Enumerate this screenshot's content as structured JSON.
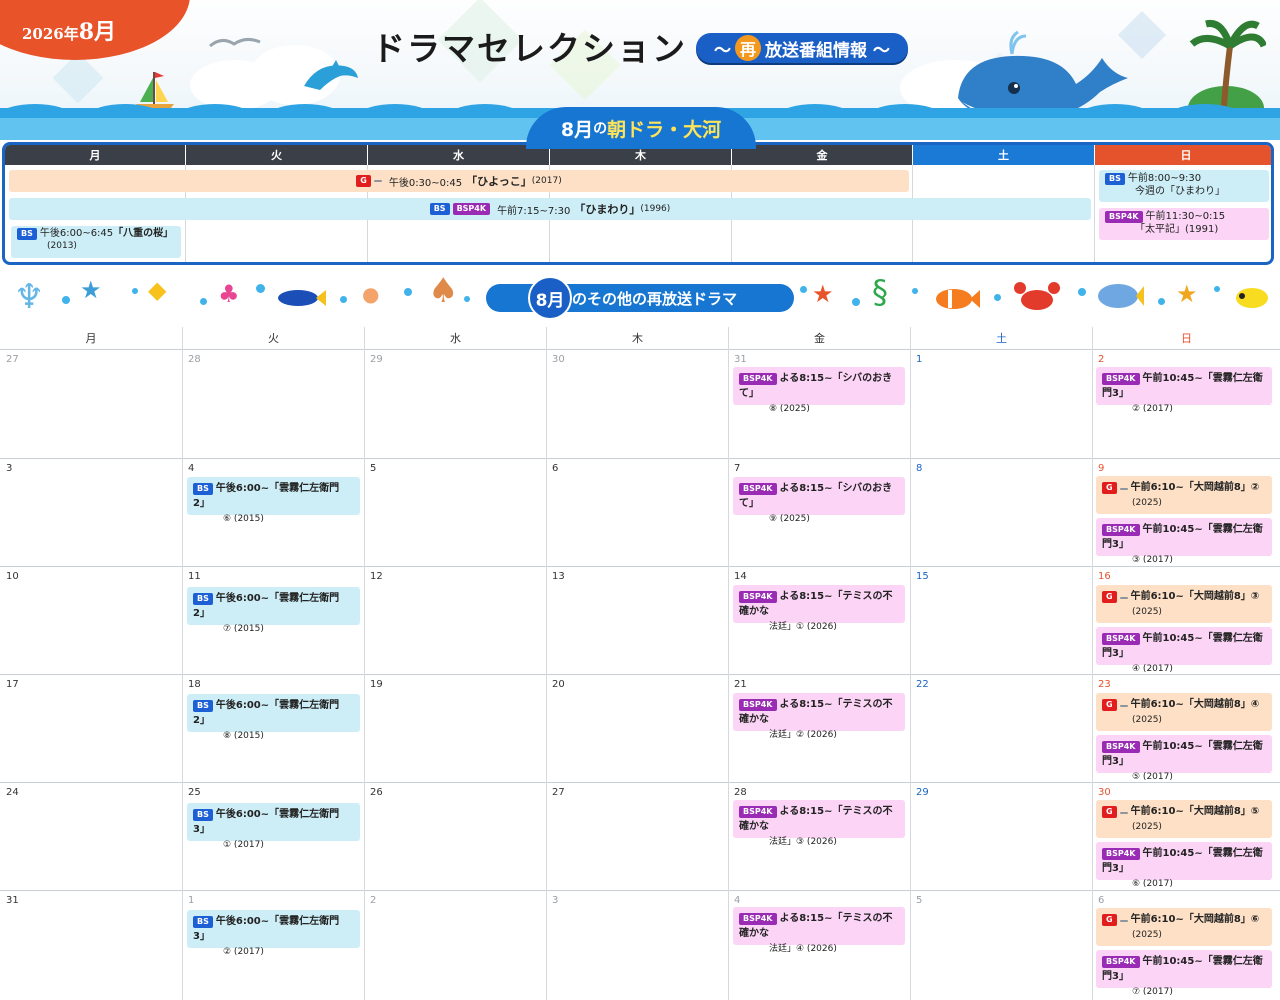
{
  "header": {
    "year": "2026年",
    "month": "8月",
    "title": "ドラマセレクション",
    "subtitle_pre": "〜",
    "subtitle_circle": "再",
    "subtitle_text": "放送番組情報 〜"
  },
  "section1": {
    "banner_month": "8月",
    "banner_text": "の",
    "banner_accent": "朝ドラ・大河",
    "days": [
      "月",
      "火",
      "水",
      "木",
      "金",
      "土",
      "日"
    ],
    "hiyokko": {
      "ch1": "G",
      "ch2": "",
      "time": "午後0:30~0:45",
      "title": "「ひよっこ」",
      "year": "(2017)"
    },
    "himawari": {
      "ch1": "BS",
      "ch2": "BSP4K",
      "time": "午前7:15~7:30",
      "title": "「ひまわり」",
      "year": "(1996)"
    },
    "yae": {
      "ch": "BS",
      "time": "午後6:00~6:45",
      "title": "「八重の桜」",
      "year": "(2013)"
    },
    "sun_bs": {
      "ch": "BS",
      "time": "午前8:00~9:30",
      "title": "今週の「ひまわり」"
    },
    "sun_4k": {
      "ch": "BSP4K",
      "time": "午前11:30~0:15",
      "title": "「太平記」(1991)"
    }
  },
  "section2": {
    "banner_month": "8月",
    "banner_text": "のその他の再放送ドラマ",
    "days": [
      "月",
      "火",
      "水",
      "木",
      "金",
      "土",
      "日"
    ]
  },
  "weeks": [
    [
      "27",
      "28",
      "29",
      "30",
      "31",
      "1",
      "2"
    ],
    [
      "3",
      "4",
      "5",
      "6",
      "7",
      "8",
      "9"
    ],
    [
      "10",
      "11",
      "12",
      "13",
      "14",
      "15",
      "16"
    ],
    [
      "17",
      "18",
      "19",
      "20",
      "21",
      "22",
      "23"
    ],
    [
      "24",
      "25",
      "26",
      "27",
      "28",
      "29",
      "30"
    ],
    [
      "31",
      "1",
      "2",
      "3",
      "4",
      "5",
      "6"
    ]
  ],
  "events": {
    "w0_fri": {
      "ch": "BSP4K",
      "l1": "よる8:15~「シバのおきて」",
      "l2": "⑧ (2025)"
    },
    "w0_sun": {
      "ch": "BSP4K",
      "l1": "午前10:45~「雲霧仁左衛門3」",
      "l2": "② (2017)"
    },
    "w1_tue": {
      "ch": "BS",
      "l1": "午後6:00~「雲霧仁左衛門2」",
      "l2": "⑥ (2015)"
    },
    "w1_fri": {
      "ch": "BSP4K",
      "l1": "よる8:15~「シバのおきて」",
      "l2": "⑨ (2025)"
    },
    "w1_sun_a": {
      "ch": "G",
      "l1": "午前6:10~「大岡越前8」②",
      "l2": "(2025)"
    },
    "w1_sun_b": {
      "ch": "BSP4K",
      "l1": "午前10:45~「雲霧仁左衛門3」",
      "l2": "③ (2017)"
    },
    "w2_tue": {
      "ch": "BS",
      "l1": "午後6:00~「雲霧仁左衛門2」",
      "l2": "⑦ (2015)"
    },
    "w2_fri": {
      "ch": "BSP4K",
      "l1": "よる8:15~「テミスの不確かな",
      "l2": "法廷」① (2026)"
    },
    "w2_sun_a": {
      "ch": "G",
      "l1": "午前6:10~「大岡越前8」③",
      "l2": "(2025)"
    },
    "w2_sun_b": {
      "ch": "BSP4K",
      "l1": "午前10:45~「雲霧仁左衛門3」",
      "l2": "④ (2017)"
    },
    "w3_tue": {
      "ch": "BS",
      "l1": "午後6:00~「雲霧仁左衛門2」",
      "l2": "⑧ (2015)"
    },
    "w3_fri": {
      "ch": "BSP4K",
      "l1": "よる8:15~「テミスの不確かな",
      "l2": "法廷」② (2026)"
    },
    "w3_sun_a": {
      "ch": "G",
      "l1": "午前6:10~「大岡越前8」④",
      "l2": "(2025)"
    },
    "w3_sun_b": {
      "ch": "BSP4K",
      "l1": "午前10:45~「雲霧仁左衛門3」",
      "l2": "⑤ (2017)"
    },
    "w4_tue": {
      "ch": "BS",
      "l1": "午後6:00~「雲霧仁左衛門3」",
      "l2": "① (2017)"
    },
    "w4_fri": {
      "ch": "BSP4K",
      "l1": "よる8:15~「テミスの不確かな",
      "l2": "法廷」③ (2026)"
    },
    "w4_sun_a": {
      "ch": "G",
      "l1": "午前6:10~「大岡越前8」⑤",
      "l2": "(2025)"
    },
    "w4_sun_b": {
      "ch": "BSP4K",
      "l1": "午前10:45~「雲霧仁左衛門3」",
      "l2": "⑥ (2017)"
    },
    "w5_tue": {
      "ch": "BS",
      "l1": "午後6:00~「雲霧仁左衛門3」",
      "l2": "② (2017)"
    },
    "w5_fri": {
      "ch": "BSP4K",
      "l1": "よる8:15~「テミスの不確かな",
      "l2": "法廷」④ (2026)"
    },
    "w5_sun_a": {
      "ch": "G",
      "l1": "午前6:10~「大岡越前8」⑥",
      "l2": "(2025)"
    },
    "w5_sun_b": {
      "ch": "BSP4K",
      "l1": "午前10:45~「雲霧仁左衛門3」",
      "l2": "⑦ (2017)"
    }
  },
  "colors": {
    "accent": "#1776d2",
    "orange": "#e8532a",
    "sat": "#1a64c4",
    "sun": "#e5532c"
  }
}
